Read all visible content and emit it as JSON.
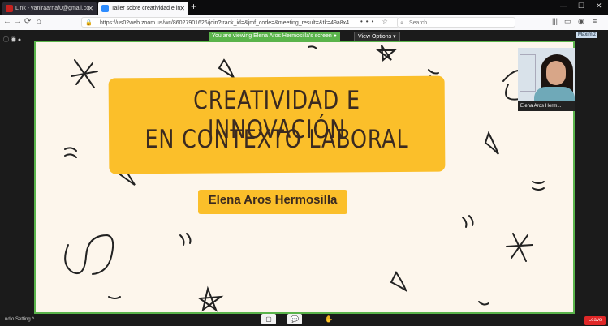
{
  "browser": {
    "tabs": [
      {
        "label": "Link - yaniraarnaf0@gmail.co",
        "favicon_color": "#c5221f",
        "active": false
      },
      {
        "label": "Taller sobre creatividad e in",
        "favicon_color": "#2d8cff",
        "active": true
      }
    ],
    "new_tab": "+",
    "window_controls": {
      "minimize": "—",
      "maximize": "☐",
      "close": "✕"
    },
    "url": "https://us02web.zoom.us/wc/86027901626/join?track_id=&jmf_code=&meeting_result=&tk=49a8x4",
    "search_placeholder": "Search",
    "nav": {
      "back": "←",
      "forward": "→",
      "reload": "⟳",
      "home": "⌂"
    },
    "url_icons": "••• ☆",
    "right_icons": [
      "|||",
      "▭",
      "◉",
      "≡"
    ]
  },
  "meeting": {
    "banner": "You are viewing Elena Aros Hermosilla's screen ●",
    "view_options": "View Options ▾",
    "top_left_icons": "ⓘ  ◉  ●",
    "maximize_label": "Maximiz",
    "participant_name": "Elena Aros Herm...",
    "toolbar": {
      "audio_label": "udio Setting ^",
      "leave_label": "Leave",
      "icons": [
        "▢",
        "💬",
        "✋"
      ]
    }
  },
  "slide": {
    "title_line1": "CREATIVIDAD E INNOVACIÓN",
    "title_line2": "EN CONTEXTO LABORAL",
    "author": "Elena Aros Hermosilla",
    "bg_color": "#fdf6ec",
    "highlight_color": "#fbbf2a",
    "text_color": "#3a2a20"
  },
  "colors": {
    "accent": "#5ab44b",
    "leave": "#e02828"
  }
}
